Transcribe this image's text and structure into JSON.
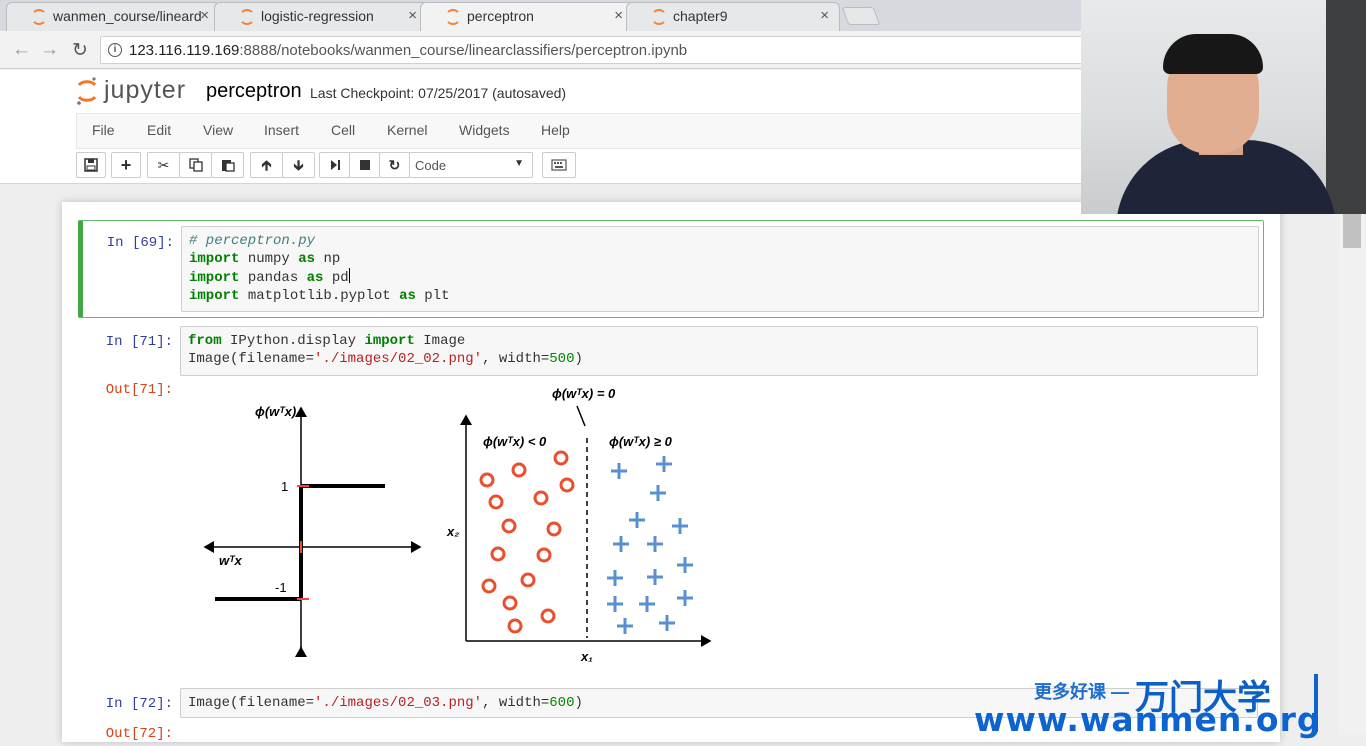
{
  "browser": {
    "tabs": [
      {
        "label": "wanmen_course/lineard"
      },
      {
        "label": "logistic-regression"
      },
      {
        "label": "perceptron"
      },
      {
        "label": "chapter9"
      }
    ],
    "close_glyph": "×",
    "url_host": "123.116.119.169",
    "url_path": ":8888/notebooks/wanmen_course/linearclassifiers/perceptron.ipynb",
    "info_glyph": "i"
  },
  "jupyter": {
    "logo_text": "jupyter",
    "notebook_name": "perceptron",
    "checkpoint": "Last Checkpoint: 07/25/2017 (autosaved)",
    "menu": [
      "File",
      "Edit",
      "View",
      "Insert",
      "Cell",
      "Kernel",
      "Widgets",
      "Help"
    ],
    "cell_type": "Code",
    "toolbar_icons": [
      "save-icon",
      "plus-icon",
      "scissors-icon",
      "copy-icon",
      "paste-icon",
      "arrow-up-icon",
      "arrow-down-icon",
      "run-icon",
      "stop-icon",
      "restart-icon",
      "keyboard-icon"
    ]
  },
  "cells": [
    {
      "prompt": "In [69]:"
    },
    {
      "prompt": "In [71]:",
      "out_prompt": "Out[71]:"
    },
    {
      "prompt": "In [72]:",
      "out_prompt": "Out[72]:"
    }
  ],
  "code": {
    "c69_l1": "# perceptron.py",
    "c69_l2_kw": "import",
    "c69_l2_rest": " numpy ",
    "c69_l2_as": "as",
    "c69_l2_tail": " np",
    "c69_l3_kw": "import",
    "c69_l3_rest": " pandas ",
    "c69_l3_as": "as",
    "c69_l3_tail": " pd",
    "c69_l4_kw": "import",
    "c69_l4_rest": " matplotlib.pyplot ",
    "c69_l4_as": "as",
    "c69_l4_tail": " plt",
    "c71_l1_from": "from",
    "c71_l1_mod": " IPython.display ",
    "c71_l1_imp": "import",
    "c71_l1_tail": " Image",
    "c71_l2_a": "Image(filename=",
    "c71_l2_str": "'./images/02_02.png'",
    "c71_l2_b": ", width=",
    "c71_l2_num": "500",
    "c71_l2_c": ")",
    "c72_l1_a": "Image(filename=",
    "c72_l1_str": "'./images/02_03.png'",
    "c72_l1_b": ", width=",
    "c72_l1_num": "600",
    "c72_l1_c": ")"
  },
  "figure": {
    "left_ylabel": "ϕ(wᵀx)",
    "left_xlabel": "wᵀx",
    "tick_1": "1",
    "tick_neg1": "-1",
    "boundary_label": "ϕ(wᵀx) = 0",
    "neg_label": "ϕ(wᵀx) < 0",
    "pos_label": "ϕ(wᵀx) ≥ 0",
    "x1_label": "x₁",
    "x2_label": "x₂",
    "colors": {
      "circle": "#e8512f",
      "plus": "#5b8fcf"
    }
  },
  "watermark": {
    "slogan": "更多好课 —",
    "brand": "万门大学",
    "url": "www.wanmen.org"
  }
}
